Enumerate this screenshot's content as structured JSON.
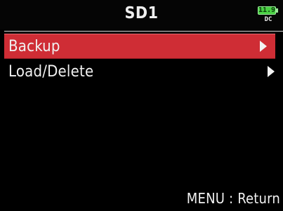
{
  "header": {
    "title": "SD1"
  },
  "status": {
    "battery_voltage": "11.9",
    "power_source": "DC",
    "battery_color": "#49d043"
  },
  "menu": {
    "items": [
      {
        "label": "Backup",
        "selected": true,
        "icon": "chevron-right-icon"
      },
      {
        "label": "Load/Delete",
        "selected": false,
        "icon": "chevron-right-icon"
      }
    ]
  },
  "footer": {
    "hint": "MENU : Return"
  },
  "colors": {
    "selection": "#cf2d35",
    "background": "#000000",
    "text": "#f1f1f1"
  }
}
